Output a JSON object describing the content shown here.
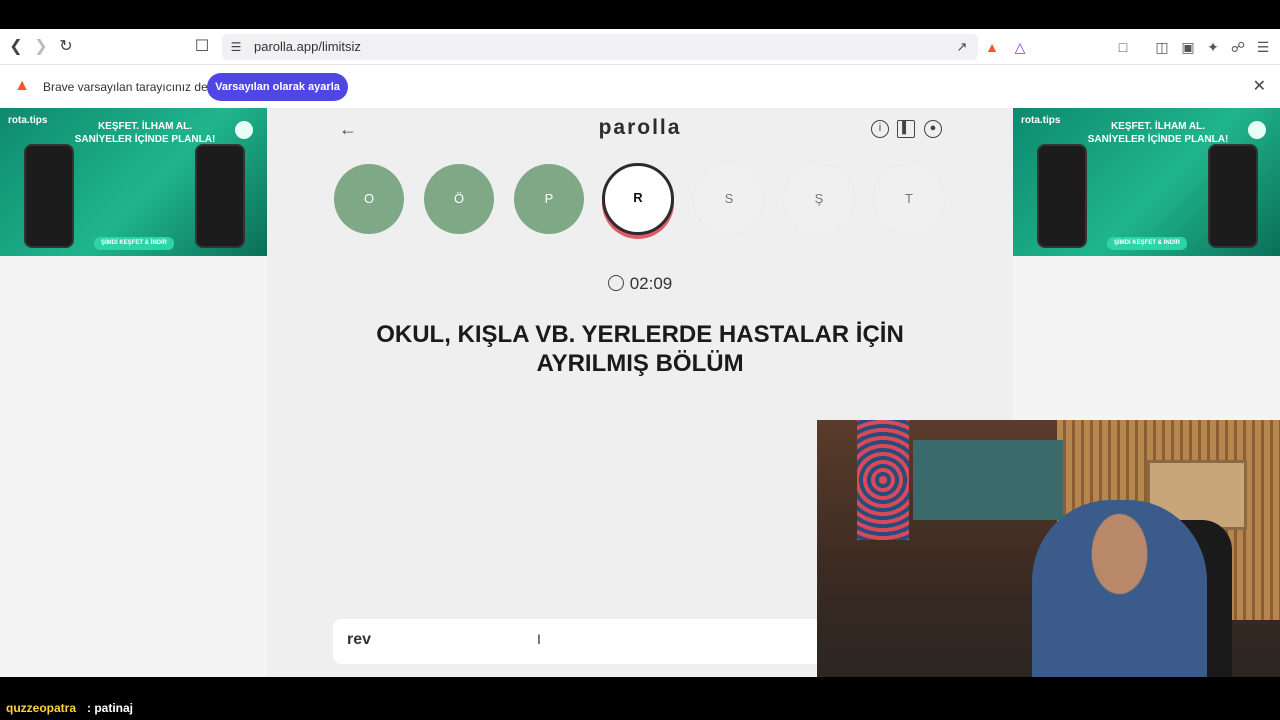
{
  "browser": {
    "url": "parolla.app/limitsiz"
  },
  "notification": {
    "text": "Brave varsayılan tarayıcınız değil",
    "button_label": "Varsayılan olarak ayarla"
  },
  "ad": {
    "brand": "rota.tips",
    "headline": "KEŞFET. İLHAM AL. SANİYELER İÇİNDE PLANLA!",
    "cta": "ŞİMDİ KEŞFET & İNDİR"
  },
  "game": {
    "logo": "parolla",
    "letters": [
      {
        "char": "O",
        "state": "done"
      },
      {
        "char": "Ö",
        "state": "done"
      },
      {
        "char": "P",
        "state": "done"
      },
      {
        "char": "R",
        "state": "active"
      },
      {
        "char": "S",
        "state": "pending"
      },
      {
        "char": "Ş",
        "state": "pending"
      },
      {
        "char": "T",
        "state": "pending"
      }
    ],
    "timer": "02:09",
    "question": "OKUL, KIŞLA VB. YERLERDE HASTALAR İÇİN AYRILMIŞ BÖLÜM",
    "answer_value": "rev"
  },
  "chat": {
    "user": "quzzeopatra",
    "message": ": patinaj"
  }
}
